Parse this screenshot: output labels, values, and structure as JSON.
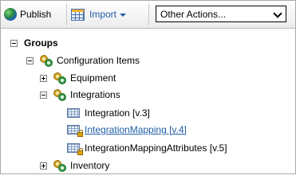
{
  "toolbar": {
    "publish_label": "Publish",
    "import_label": "Import",
    "actions_select_value": "Other Actions..."
  },
  "tree": {
    "root": {
      "label": "Groups",
      "expanded": true
    },
    "configuration_items": {
      "label": "Configuration Items",
      "expanded": true
    },
    "equipment": {
      "label": "Equipment",
      "expanded": false
    },
    "integrations": {
      "label": "Integrations",
      "expanded": true
    },
    "integration": {
      "label": "Integration [v.3]"
    },
    "integration_mapping": {
      "label": "IntegrationMapping [v.4]"
    },
    "integration_mapping_attributes": {
      "label": "IntegrationMappingAttributes [v.5]"
    },
    "inventory": {
      "label": "Inventory",
      "expanded": false
    }
  },
  "icons": {
    "publish": "globe-icon",
    "import": "grid-icon",
    "group": "gears-icon",
    "table": "table-icon",
    "locked_table": "locked-table-icon"
  },
  "colors": {
    "link": "#1f5ea8",
    "frame_border": "#a9a9a9"
  }
}
